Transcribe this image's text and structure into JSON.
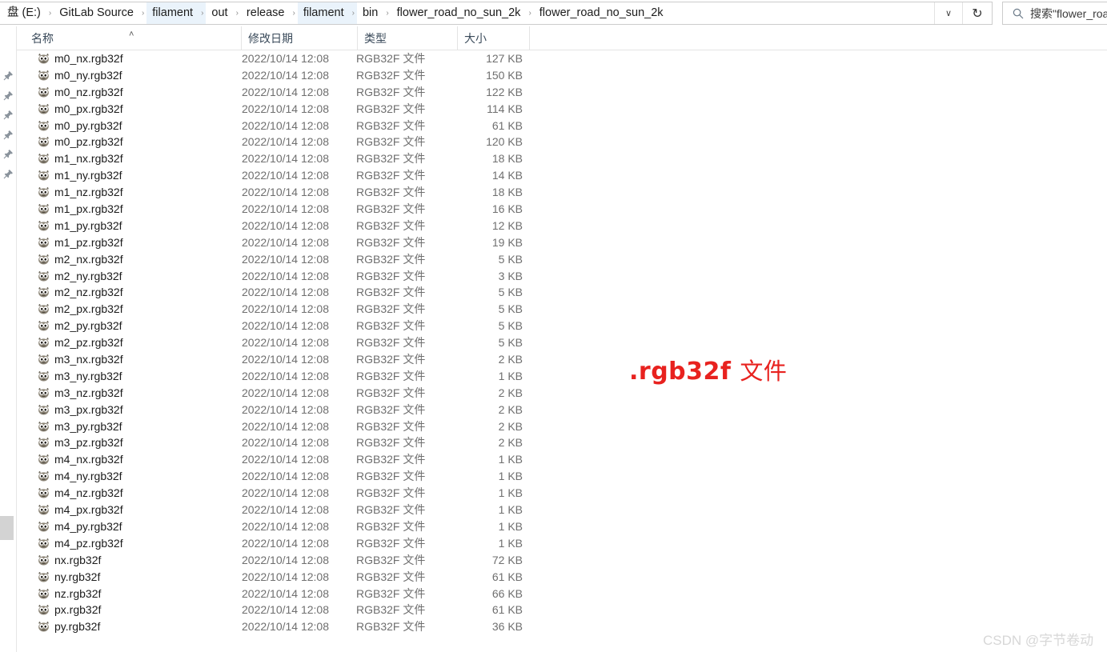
{
  "window": {
    "address": {
      "crumbs": [
        {
          "label": "盘 (E:)",
          "highlight": false
        },
        {
          "label": "GitLab Source",
          "highlight": false
        },
        {
          "label": "filament",
          "highlight": true
        },
        {
          "label": "out",
          "highlight": false
        },
        {
          "label": "release",
          "highlight": false
        },
        {
          "label": "filament",
          "highlight": true
        },
        {
          "label": "bin",
          "highlight": false
        },
        {
          "label": "flower_road_no_sun_2k",
          "highlight": false
        },
        {
          "label": "flower_road_no_sun_2k",
          "highlight": false
        }
      ],
      "separator": "›",
      "dropdown_glyph": "∨",
      "refresh_glyph": "↻"
    },
    "search": {
      "value": "搜索\"flower_roa",
      "icon": "search-icon"
    }
  },
  "nav_pane": {
    "pin_count": 6,
    "pin_icon": "pin-icon"
  },
  "columns": [
    {
      "key": "name",
      "label": "名称",
      "sort": "ascending"
    },
    {
      "key": "date",
      "label": "修改日期",
      "sort": null
    },
    {
      "key": "type",
      "label": "类型",
      "sort": null
    },
    {
      "key": "size",
      "label": "大小",
      "sort": null
    }
  ],
  "sort_caret_glyph": "˄",
  "files": [
    {
      "name": "m0_nx.rgb32f",
      "date": "2022/10/14 12:08",
      "type": "RGB32F 文件",
      "size": "127 KB"
    },
    {
      "name": "m0_ny.rgb32f",
      "date": "2022/10/14 12:08",
      "type": "RGB32F 文件",
      "size": "150 KB"
    },
    {
      "name": "m0_nz.rgb32f",
      "date": "2022/10/14 12:08",
      "type": "RGB32F 文件",
      "size": "122 KB"
    },
    {
      "name": "m0_px.rgb32f",
      "date": "2022/10/14 12:08",
      "type": "RGB32F 文件",
      "size": "114 KB"
    },
    {
      "name": "m0_py.rgb32f",
      "date": "2022/10/14 12:08",
      "type": "RGB32F 文件",
      "size": "61 KB"
    },
    {
      "name": "m0_pz.rgb32f",
      "date": "2022/10/14 12:08",
      "type": "RGB32F 文件",
      "size": "120 KB"
    },
    {
      "name": "m1_nx.rgb32f",
      "date": "2022/10/14 12:08",
      "type": "RGB32F 文件",
      "size": "18 KB"
    },
    {
      "name": "m1_ny.rgb32f",
      "date": "2022/10/14 12:08",
      "type": "RGB32F 文件",
      "size": "14 KB"
    },
    {
      "name": "m1_nz.rgb32f",
      "date": "2022/10/14 12:08",
      "type": "RGB32F 文件",
      "size": "18 KB"
    },
    {
      "name": "m1_px.rgb32f",
      "date": "2022/10/14 12:08",
      "type": "RGB32F 文件",
      "size": "16 KB"
    },
    {
      "name": "m1_py.rgb32f",
      "date": "2022/10/14 12:08",
      "type": "RGB32F 文件",
      "size": "12 KB"
    },
    {
      "name": "m1_pz.rgb32f",
      "date": "2022/10/14 12:08",
      "type": "RGB32F 文件",
      "size": "19 KB"
    },
    {
      "name": "m2_nx.rgb32f",
      "date": "2022/10/14 12:08",
      "type": "RGB32F 文件",
      "size": "5 KB"
    },
    {
      "name": "m2_ny.rgb32f",
      "date": "2022/10/14 12:08",
      "type": "RGB32F 文件",
      "size": "3 KB"
    },
    {
      "name": "m2_nz.rgb32f",
      "date": "2022/10/14 12:08",
      "type": "RGB32F 文件",
      "size": "5 KB"
    },
    {
      "name": "m2_px.rgb32f",
      "date": "2022/10/14 12:08",
      "type": "RGB32F 文件",
      "size": "5 KB"
    },
    {
      "name": "m2_py.rgb32f",
      "date": "2022/10/14 12:08",
      "type": "RGB32F 文件",
      "size": "5 KB"
    },
    {
      "name": "m2_pz.rgb32f",
      "date": "2022/10/14 12:08",
      "type": "RGB32F 文件",
      "size": "5 KB"
    },
    {
      "name": "m3_nx.rgb32f",
      "date": "2022/10/14 12:08",
      "type": "RGB32F 文件",
      "size": "2 KB"
    },
    {
      "name": "m3_ny.rgb32f",
      "date": "2022/10/14 12:08",
      "type": "RGB32F 文件",
      "size": "1 KB"
    },
    {
      "name": "m3_nz.rgb32f",
      "date": "2022/10/14 12:08",
      "type": "RGB32F 文件",
      "size": "2 KB"
    },
    {
      "name": "m3_px.rgb32f",
      "date": "2022/10/14 12:08",
      "type": "RGB32F 文件",
      "size": "2 KB"
    },
    {
      "name": "m3_py.rgb32f",
      "date": "2022/10/14 12:08",
      "type": "RGB32F 文件",
      "size": "2 KB"
    },
    {
      "name": "m3_pz.rgb32f",
      "date": "2022/10/14 12:08",
      "type": "RGB32F 文件",
      "size": "2 KB"
    },
    {
      "name": "m4_nx.rgb32f",
      "date": "2022/10/14 12:08",
      "type": "RGB32F 文件",
      "size": "1 KB"
    },
    {
      "name": "m4_ny.rgb32f",
      "date": "2022/10/14 12:08",
      "type": "RGB32F 文件",
      "size": "1 KB"
    },
    {
      "name": "m4_nz.rgb32f",
      "date": "2022/10/14 12:08",
      "type": "RGB32F 文件",
      "size": "1 KB"
    },
    {
      "name": "m4_px.rgb32f",
      "date": "2022/10/14 12:08",
      "type": "RGB32F 文件",
      "size": "1 KB"
    },
    {
      "name": "m4_py.rgb32f",
      "date": "2022/10/14 12:08",
      "type": "RGB32F 文件",
      "size": "1 KB"
    },
    {
      "name": "m4_pz.rgb32f",
      "date": "2022/10/14 12:08",
      "type": "RGB32F 文件",
      "size": "1 KB"
    },
    {
      "name": "nx.rgb32f",
      "date": "2022/10/14 12:08",
      "type": "RGB32F 文件",
      "size": "72 KB"
    },
    {
      "name": "ny.rgb32f",
      "date": "2022/10/14 12:08",
      "type": "RGB32F 文件",
      "size": "61 KB"
    },
    {
      "name": "nz.rgb32f",
      "date": "2022/10/14 12:08",
      "type": "RGB32F 文件",
      "size": "66 KB"
    },
    {
      "name": "px.rgb32f",
      "date": "2022/10/14 12:08",
      "type": "RGB32F 文件",
      "size": "61 KB"
    },
    {
      "name": "py.rgb32f",
      "date": "2022/10/14 12:08",
      "type": "RGB32F 文件",
      "size": "36 KB"
    }
  ],
  "file_icon": "gimp-wilber-icon",
  "annotation": {
    "ext": ".rgb32f",
    "word": "文件",
    "color": "#e8221f"
  },
  "watermark": {
    "text": "CSDN @字节卷动",
    "color": "#d7d7d7"
  }
}
